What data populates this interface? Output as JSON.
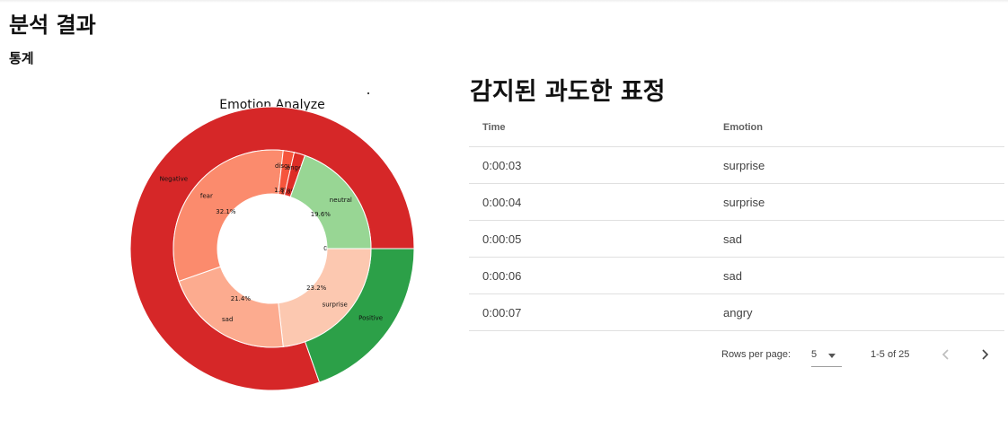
{
  "page": {
    "title": "분석 결과",
    "stats_title": "통계"
  },
  "chart_data": {
    "type": "pie",
    "title": "Emotion Analyze",
    "outer": [
      {
        "label": "Negative",
        "value": 80.4,
        "color": "#d62728"
      },
      {
        "label": "Positive",
        "value": 19.6,
        "color": "#2ca048"
      }
    ],
    "inner": [
      {
        "label": "happy",
        "value": 0.0,
        "pct_label": "0.0%",
        "color": "#bfe5b4"
      },
      {
        "label": "surprise",
        "value": 23.2,
        "pct_label": "23.2%",
        "color": "#fcc8b0"
      },
      {
        "label": "sad",
        "value": 21.4,
        "pct_label": "21.4%",
        "color": "#fcab8f"
      },
      {
        "label": "fear",
        "value": 32.1,
        "pct_label": "32.1%",
        "color": "#fb8b6d"
      },
      {
        "label": "disgust",
        "value": 1.8,
        "pct_label": "1.8%",
        "color": "#f6553c"
      },
      {
        "label": "anger",
        "value": 1.8,
        "pct_label": "1.8%",
        "color": "#de2d26"
      },
      {
        "label": "neutral",
        "value": 19.6,
        "pct_label": "19.6%",
        "color": "#98d694"
      }
    ]
  },
  "table": {
    "title": "감지된 과도한 표정",
    "columns": [
      "Time",
      "Emotion"
    ],
    "rows": [
      [
        "0:00:03",
        "surprise"
      ],
      [
        "0:00:04",
        "surprise"
      ],
      [
        "0:00:05",
        "sad"
      ],
      [
        "0:00:06",
        "sad"
      ],
      [
        "0:00:07",
        "angry"
      ]
    ]
  },
  "pagination": {
    "rows_per_page_label": "Rows per page:",
    "rows_per_page": "5",
    "range": "1-5 of 25",
    "prev_icon": "chevron-left-icon",
    "next_icon": "chevron-right-icon"
  }
}
